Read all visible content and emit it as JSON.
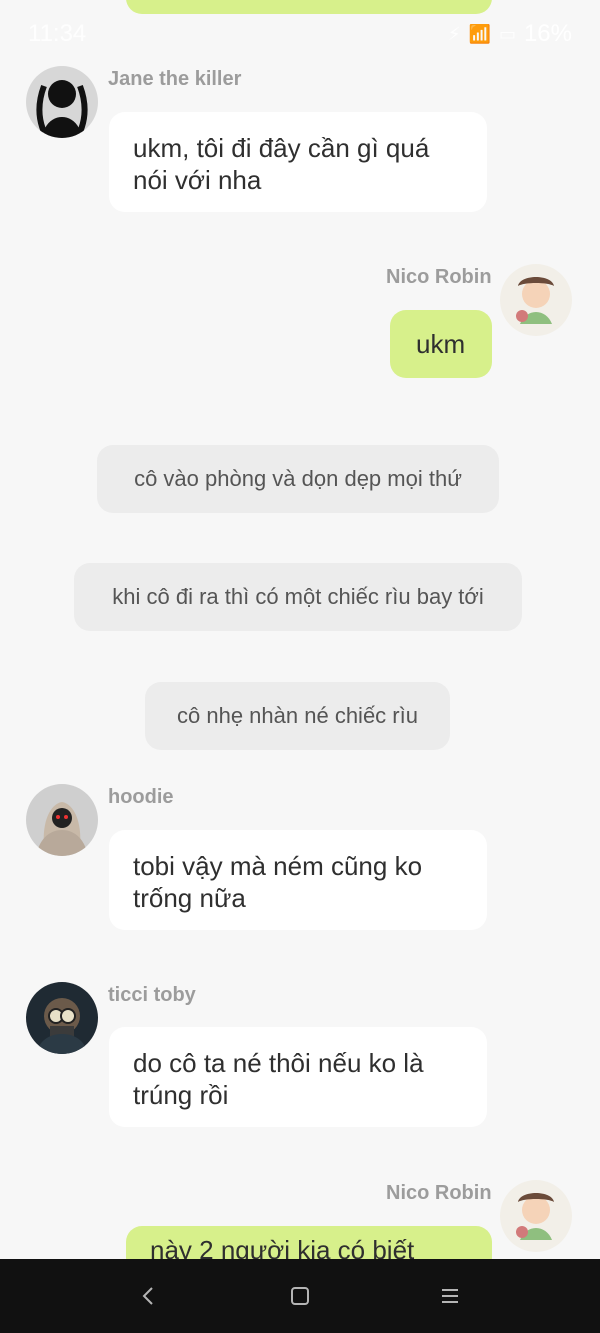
{
  "status_bar": {
    "time": "11:34",
    "battery": "16%"
  },
  "messages": [
    {
      "sender": "Jane the killer",
      "text": "ukm, tôi đi đây cần gì quá nói với nha"
    },
    {
      "sender": "Nico Robin",
      "text": "ukm"
    },
    {
      "narration": "cô vào phòng và dọn dẹp mọi thứ"
    },
    {
      "narration": "khi cô đi ra thì có một chiếc rìu bay tới"
    },
    {
      "narration": "cô nhẹ nhàn né chiếc rìu"
    },
    {
      "sender": "hoodie",
      "text": "tobi vậy mà ném cũng ko trống nữa"
    },
    {
      "sender": "ticci toby",
      "text": "do cô ta né thôi nếu ko là trúng rồi"
    },
    {
      "sender": "Nico Robin",
      "text": "này 2 người kia có biết"
    }
  ]
}
